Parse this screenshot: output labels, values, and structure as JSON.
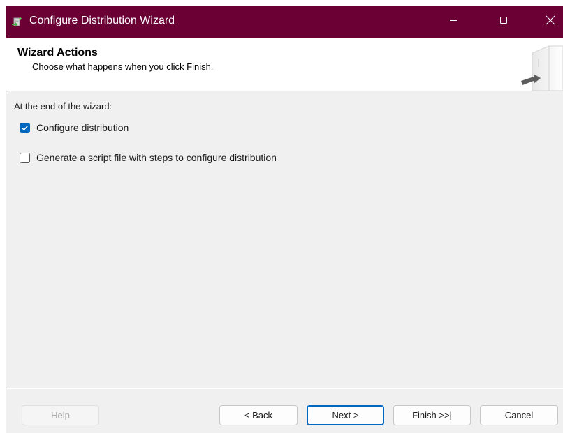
{
  "window": {
    "title": "Configure Distribution Wizard",
    "title_bar_color": "#6b0035",
    "icons": {
      "app": "wizard-app-icon",
      "minimize": "minimize-icon",
      "maximize": "maximize-icon",
      "close": "close-icon"
    }
  },
  "header": {
    "title": "Wizard Actions",
    "subtitle": "Choose what happens when you click Finish.",
    "graphic": "wizard-graphic-icon"
  },
  "body": {
    "intro": "At the end of the wizard:",
    "options": [
      {
        "label": "Configure distribution",
        "checked": true
      },
      {
        "label": "Generate a script file with steps to configure distribution",
        "checked": false
      }
    ],
    "accent_color": "#0067c0"
  },
  "footer": {
    "help_label": "Help",
    "back_label": "< Back",
    "next_label": "Next >",
    "finish_label": "Finish >>|",
    "cancel_label": "Cancel"
  }
}
